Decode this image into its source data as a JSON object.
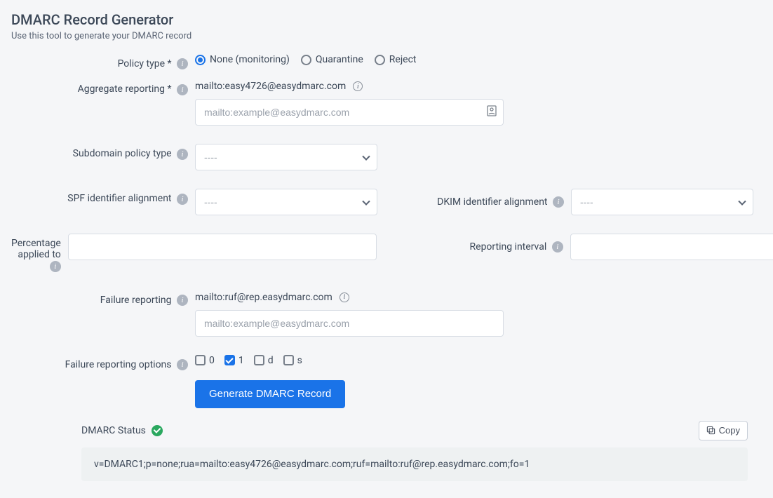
{
  "title": "DMARC Record Generator",
  "subtitle": "Use this tool to generate your DMARC record",
  "labels": {
    "policy_type": "Policy type *",
    "aggregate_reporting": "Aggregate reporting *",
    "subdomain_policy": "Subdomain policy type",
    "spf_alignment": "SPF identifier alignment",
    "dkim_alignment": "DKIM identifier alignment",
    "percentage": "Percentage applied to",
    "reporting_interval": "Reporting interval",
    "failure_reporting": "Failure reporting",
    "failure_options": "Failure reporting options"
  },
  "policy_options": {
    "none": "None (monitoring)",
    "quarantine": "Quarantine",
    "reject": "Reject"
  },
  "policy_selected": "none",
  "aggregate_reporting_value": "mailto:easy4726@easydmarc.com",
  "email_placeholder": "mailto:example@easydmarc.com",
  "select_placeholder": "----",
  "failure_reporting_value": "mailto:ruf@rep.easydmarc.com",
  "failure_option_flags": {
    "o0": {
      "label": "0",
      "checked": false
    },
    "o1": {
      "label": "1",
      "checked": true
    },
    "od": {
      "label": "d",
      "checked": false
    },
    "os": {
      "label": "s",
      "checked": false
    }
  },
  "generate_button": "Generate DMARC Record",
  "status_label": "DMARC Status",
  "copy_label": "Copy",
  "record_text": "v=DMARC1;p=none;rua=mailto:easy4726@easydmarc.com;ruf=mailto:ruf@rep.easydmarc.com;fo=1"
}
